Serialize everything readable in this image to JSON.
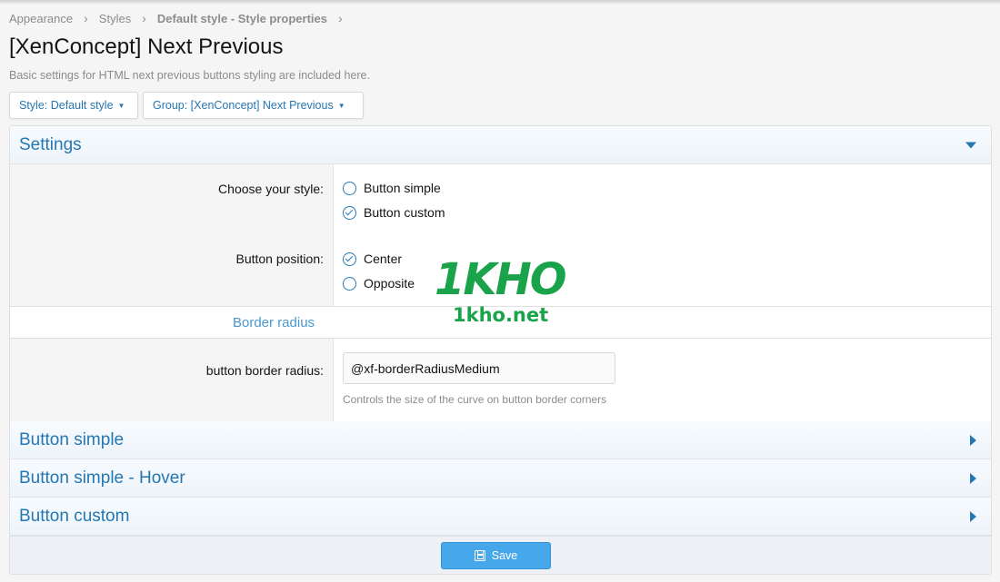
{
  "breadcrumb": [
    {
      "label": "Appearance",
      "bold": false
    },
    {
      "label": "Styles",
      "bold": false
    },
    {
      "label": "Default style - Style properties",
      "bold": true
    }
  ],
  "page": {
    "title": "[XenConcept] Next Previous",
    "description": "Basic settings for HTML next previous buttons styling are included here."
  },
  "filters": {
    "style_label": "Style: Default style",
    "group_label": "Group: [XenConcept] Next Previous"
  },
  "settings": {
    "header": "Settings",
    "choose_style": {
      "label": "Choose your style:",
      "options": [
        {
          "label": "Button simple",
          "checked": false
        },
        {
          "label": "Button custom",
          "checked": true
        }
      ]
    },
    "button_position": {
      "label": "Button position:",
      "options": [
        {
          "label": "Center",
          "checked": true
        },
        {
          "label": "Opposite",
          "checked": false
        }
      ]
    },
    "border_radius_header": "Border radius",
    "border_radius": {
      "label": "button border radius:",
      "value": "@xf-borderRadiusMedium",
      "hint": "Controls the size of the curve on button border corners"
    }
  },
  "collapsed_sections": [
    "Button simple",
    "Button simple - Hover",
    "Button custom"
  ],
  "footer": {
    "save_label": "Save"
  },
  "watermark": {
    "big": "1KHO",
    "small": "1kho.net"
  },
  "colors": {
    "accent": "#2577b1",
    "save_button": "#47a7eb",
    "watermark": "#1aa34a"
  }
}
